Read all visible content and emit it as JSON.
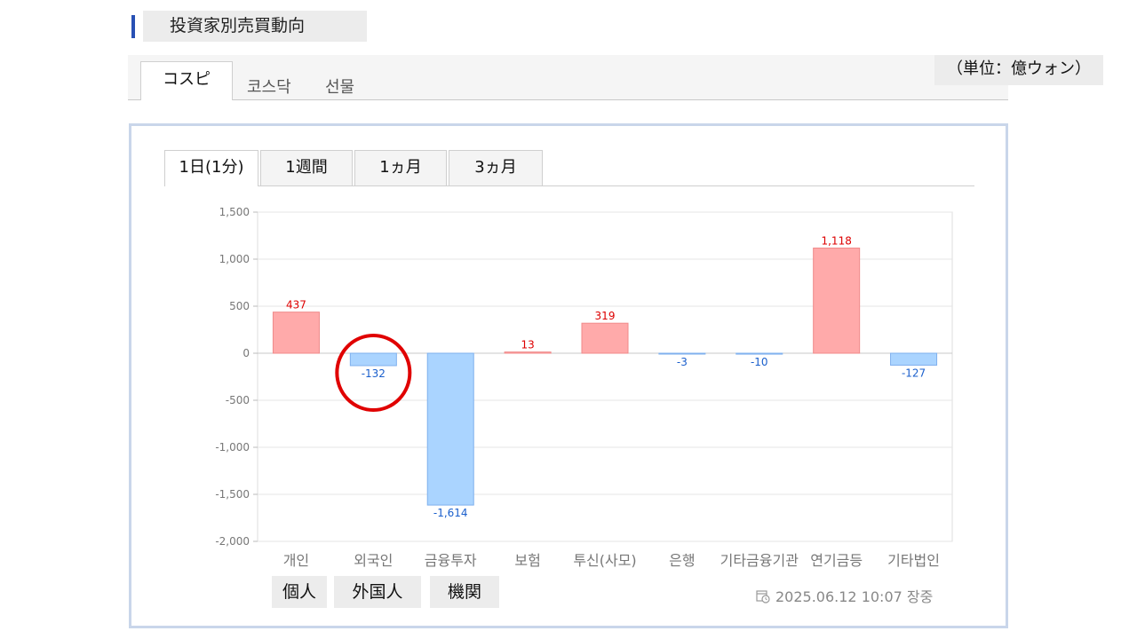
{
  "header": {
    "title": "投資家別売買動向"
  },
  "market_tabs": [
    "コスピ",
    "코스닥",
    "선물"
  ],
  "unit_label": "（単位：億ウォン）",
  "period_tabs": [
    "1日(1分)",
    "1週間",
    "1ヵ月",
    "3ヵ月"
  ],
  "legend_chips": [
    "個人",
    "外国人",
    "機関"
  ],
  "timestamp": "2025.06.12 10:07 장중",
  "colors": {
    "positive_fill": "#ffaaaa",
    "positive_edge": "#f08a8a",
    "negative_fill": "#aad4ff",
    "negative_edge": "#7fb0ee",
    "positive_text": "#dd0000",
    "negative_text": "#1a5fcc",
    "highlight_circle": "#e00000"
  },
  "chart_data": {
    "type": "bar",
    "categories": [
      "개인",
      "외국인",
      "금융투자",
      "보험",
      "투신(사모)",
      "은행",
      "기타금융",
      "기관",
      "연기금등",
      "기타법인"
    ],
    "category_labels_display": [
      "개인",
      "외국인",
      "금융투자",
      "보험",
      "투신(사모)",
      "은행",
      "기타금융기관",
      "연기금등",
      "기타법인"
    ],
    "values": [
      437,
      -132,
      -1614,
      13,
      319,
      -3,
      -10,
      1118,
      -127
    ],
    "value_labels": [
      "437",
      "-132",
      "-1,614",
      "13",
      "319",
      "-3",
      "-10",
      "1,118",
      "-127"
    ],
    "yticks": [
      "1,500",
      "1,000",
      "500",
      "0",
      "-500",
      "-1,000",
      "-1,500",
      "-2,000"
    ],
    "ylim": [
      -2000,
      1500
    ],
    "grid": true,
    "highlight_index": 1
  }
}
